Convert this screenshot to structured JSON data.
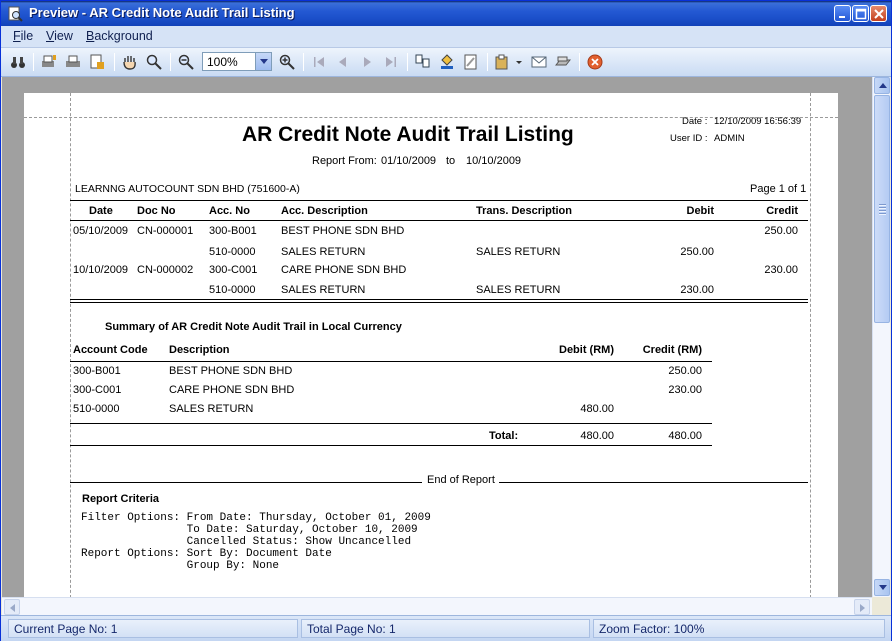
{
  "window": {
    "title": "Preview - AR Credit Note Audit Trail Listing"
  },
  "menu": {
    "file": "File",
    "view": "View",
    "background": "Background"
  },
  "toolbar": {
    "zoom_value": "100%"
  },
  "report": {
    "date_label": "Date :",
    "date_value": "12/10/2009 16:56:39",
    "userid_label": "User ID :",
    "userid_value": "ADMIN",
    "title": "AR Credit Note Audit Trail Listing",
    "report_from_label": "Report From:",
    "from_date": "01/10/2009",
    "to_label": "to",
    "to_date": "10/10/2009",
    "company": "LEARNNG AUTOCOUNT SDN BHD (751600-A)",
    "page_info": "Page 1 of 1",
    "columns": {
      "date": "Date",
      "doc_no": "Doc No",
      "acc_no": "Acc. No",
      "acc_desc": "Acc. Description",
      "trans_desc": "Trans. Description",
      "debit": "Debit",
      "credit": "Credit"
    },
    "rows": [
      {
        "date": "05/10/2009",
        "doc_no": "CN-000001",
        "acc_no": "300-B001",
        "acc_desc": "BEST PHONE SDN BHD",
        "trans_desc": "",
        "debit": "",
        "credit": "250.00"
      },
      {
        "date": "",
        "doc_no": "",
        "acc_no": "510-0000",
        "acc_desc": "SALES RETURN",
        "trans_desc": "SALES RETURN",
        "debit": "250.00",
        "credit": ""
      },
      {
        "date": "10/10/2009",
        "doc_no": "CN-000002",
        "acc_no": "300-C001",
        "acc_desc": "CARE PHONE SDN BHD",
        "trans_desc": "",
        "debit": "",
        "credit": "230.00"
      },
      {
        "date": "",
        "doc_no": "",
        "acc_no": "510-0000",
        "acc_desc": "SALES RETURN",
        "trans_desc": "SALES RETURN",
        "debit": "230.00",
        "credit": ""
      }
    ],
    "summary": {
      "title": "Summary of AR Credit Note Audit Trail in Local Currency",
      "columns": {
        "account_code": "Account Code",
        "description": "Description",
        "debit": "Debit (RM)",
        "credit": "Credit (RM)"
      },
      "rows": [
        {
          "account_code": "300-B001",
          "description": "BEST PHONE SDN BHD",
          "debit": "",
          "credit": "250.00"
        },
        {
          "account_code": "300-C001",
          "description": "CARE PHONE SDN BHD",
          "debit": "",
          "credit": "230.00"
        },
        {
          "account_code": "510-0000",
          "description": "SALES RETURN",
          "debit": "480.00",
          "credit": ""
        }
      ],
      "total_label": "Total:",
      "total_debit": "480.00",
      "total_credit": "480.00"
    },
    "end_of_report": "End of Report",
    "criteria": {
      "title": "Report Criteria",
      "lines": [
        "Filter Options: From Date: Thursday, October 01, 2009",
        "                To Date: Saturday, October 10, 2009",
        "                Cancelled Status: Show Uncancelled",
        "Report Options: Sort By: Document Date",
        "                Group By: None"
      ]
    }
  },
  "status": {
    "current_page": "Current Page No: 1",
    "total_page": "Total Page No: 1",
    "zoom_factor": "Zoom Factor: 100%"
  }
}
